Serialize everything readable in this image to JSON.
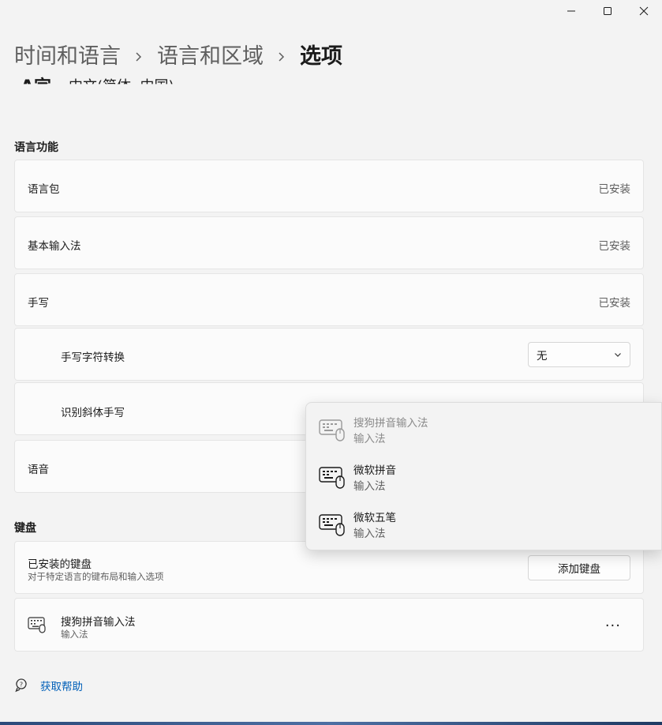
{
  "breadcrumb": {
    "items": [
      "时间和语言",
      "语言和区域",
      "选项"
    ]
  },
  "language_peek": {
    "icon_text": "A字",
    "name": "中文(简体, 中国)"
  },
  "language_features": {
    "title": "语言功能",
    "items": {
      "pack": {
        "label": "语言包",
        "status": "已安装"
      },
      "basic_input": {
        "label": "基本输入法",
        "status": "已安装"
      },
      "handwriting": {
        "label": "手写",
        "status": "已安装"
      },
      "char_conversion": {
        "label": "手写字符转换",
        "selected": "无"
      },
      "italic": {
        "label": "识别斜体手写"
      },
      "speech": {
        "label": "语音"
      }
    }
  },
  "keyboard": {
    "title": "键盘",
    "installed": {
      "label": "已安装的键盘",
      "sub": "对于特定语言的键布局和输入选项",
      "add_button": "添加键盘"
    },
    "items": [
      {
        "name": "搜狗拼音输入法",
        "type": "输入法",
        "more": "···"
      }
    ]
  },
  "flyout": {
    "items": [
      {
        "name": "搜狗拼音输入法",
        "type": "输入法",
        "disabled": true
      },
      {
        "name": "微软拼音",
        "type": "输入法",
        "disabled": false
      },
      {
        "name": "微软五笔",
        "type": "输入法",
        "disabled": false
      }
    ]
  },
  "help": {
    "label": "获取帮助"
  },
  "colors": {
    "link": "#005fb8",
    "background": "#f3f3f3",
    "card": "#fbfbfb"
  }
}
